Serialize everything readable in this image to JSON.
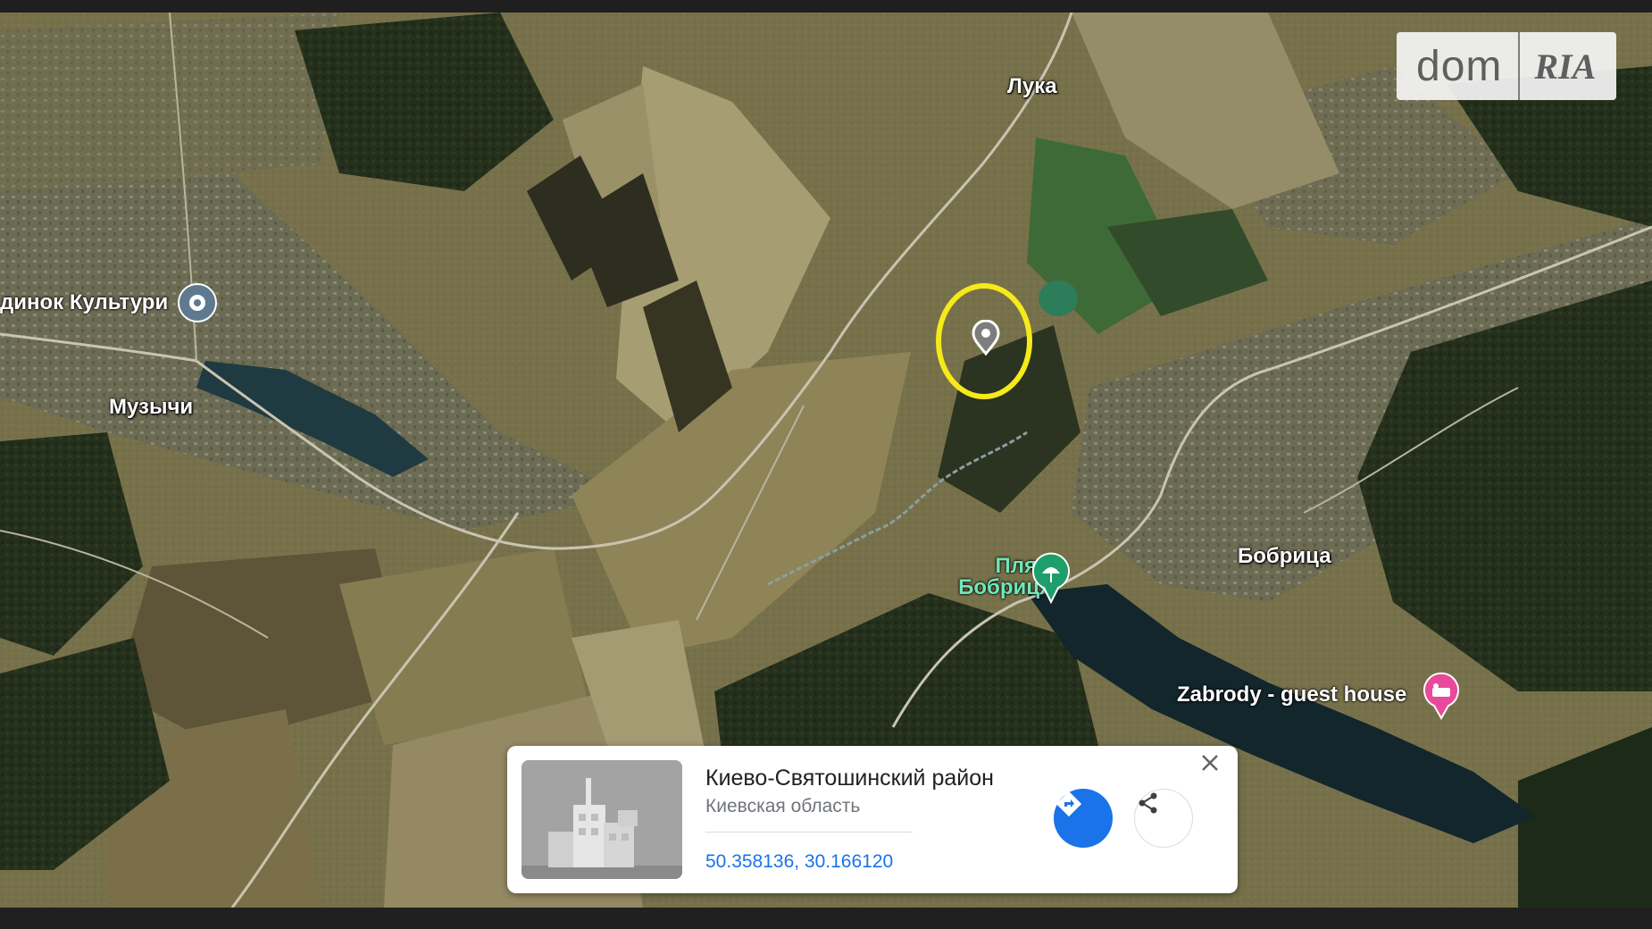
{
  "map": {
    "type": "satellite",
    "place_labels": [
      {
        "id": "luka",
        "text": "Лука"
      },
      {
        "id": "muzychi",
        "text": "Музычи"
      },
      {
        "id": "bobrytsa",
        "text": "Бобрица"
      }
    ],
    "pois": [
      {
        "id": "culture-house",
        "text": "динок Культури",
        "icon": "pin-icon",
        "color": "#5f7a8f"
      },
      {
        "id": "beach",
        "text": "Пляж\nБобриця",
        "icon": "beach-umbrella-icon",
        "color": "#1e9e6a"
      },
      {
        "id": "guest-house",
        "text": "Zabrody - guest house",
        "icon": "bed-icon",
        "color": "#e8499a"
      }
    ],
    "highlight": {
      "icon": "location-pin-icon",
      "ring_color": "#f5ea1a"
    }
  },
  "logo": {
    "dom": "dom",
    "ria": "RIA"
  },
  "info_card": {
    "title": "Киево-Святошинский район",
    "subtitle": "Киевская область",
    "coordinates": "50.358136, 30.166120",
    "directions_icon": "directions-icon",
    "share_icon": "share-icon",
    "close_icon": "close-icon",
    "accent_color": "#1a73e8"
  }
}
